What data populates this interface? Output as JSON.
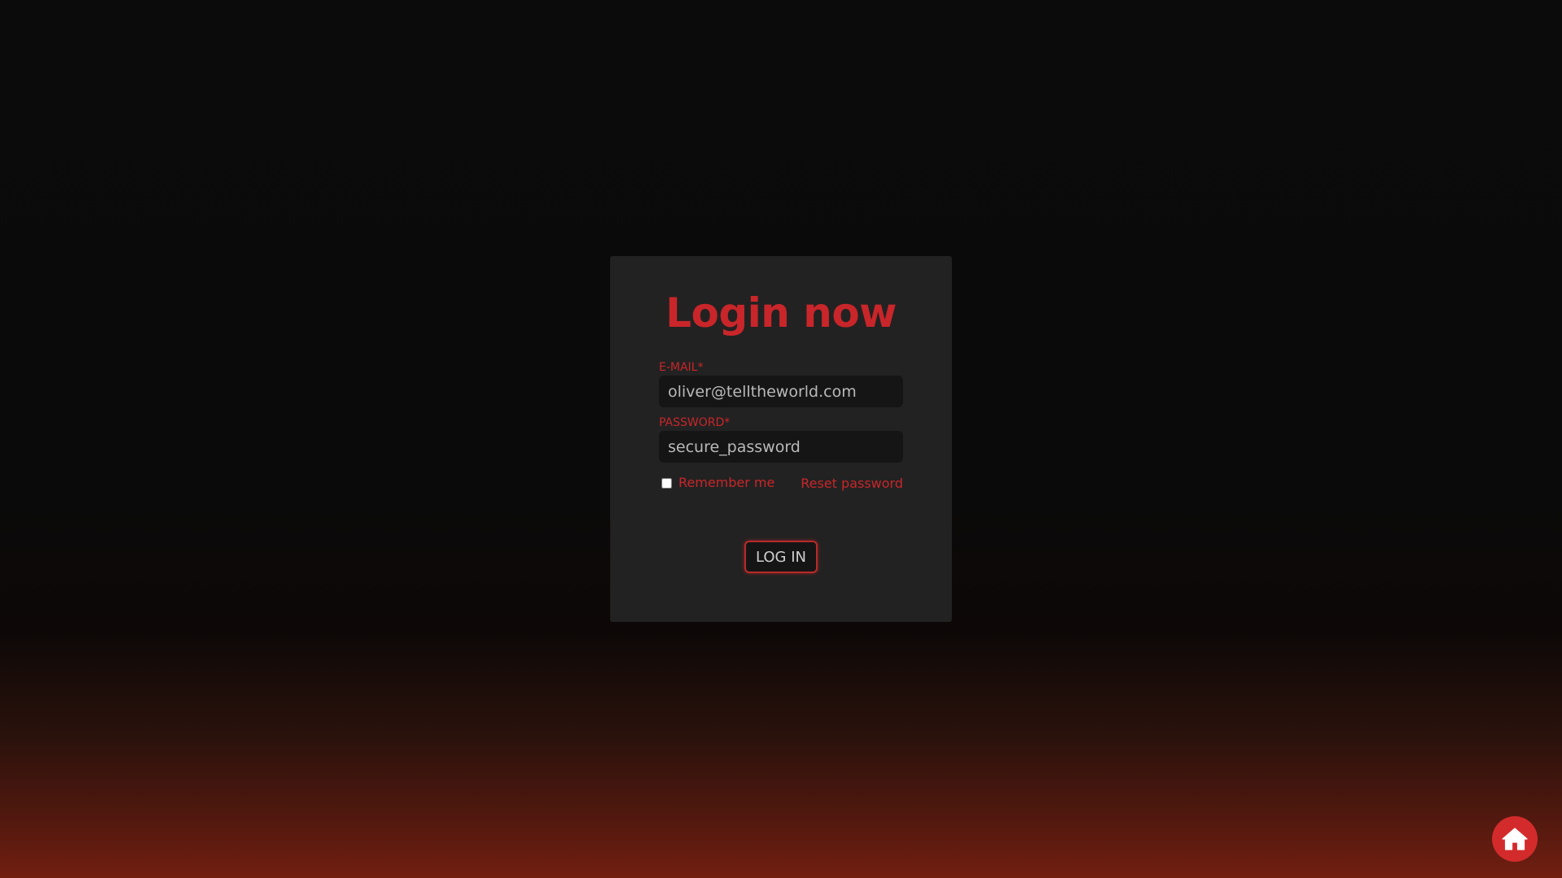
{
  "login_card": {
    "title": "Login now",
    "email": {
      "label": "E-MAIL*",
      "value": "oliver@telltheworld.com"
    },
    "password": {
      "label": "PASSWORD*",
      "value": "secure_password"
    },
    "remember_me": {
      "label": "Remember me",
      "checked": false
    },
    "reset_password_label": "Reset password",
    "login_button_label": "LOG IN"
  },
  "home_button": {
    "icon": "home-icon"
  },
  "colors": {
    "accent": "#c8262a",
    "card_background": "#222222",
    "input_background": "#151515",
    "page_background_top": "#0b0b0b",
    "page_background_bottom": "#721f10",
    "home_button": "#d32b2c"
  }
}
